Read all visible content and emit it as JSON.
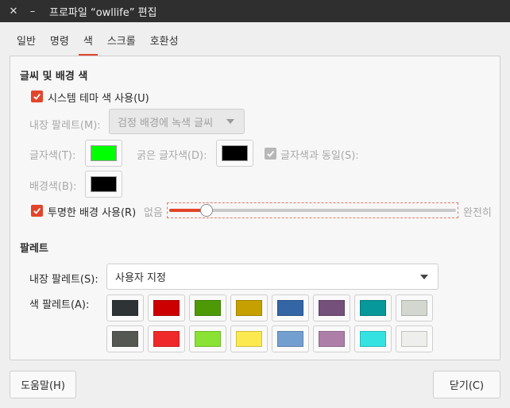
{
  "window": {
    "title": "프로파일 “owllife” 편집",
    "close_glyph": "✕",
    "minimize_glyph": "–"
  },
  "tabs": [
    {
      "label": "일반",
      "active": false
    },
    {
      "label": "명령",
      "active": false
    },
    {
      "label": "색",
      "active": true
    },
    {
      "label": "스크롤",
      "active": false
    },
    {
      "label": "호환성",
      "active": false
    }
  ],
  "text_bg": {
    "heading": "글씨 및 배경 색",
    "use_system_theme": {
      "label": "시스템 테마 색 사용(U)",
      "checked": true
    },
    "builtin_scheme": {
      "label": "내장 팔레트(M):",
      "value": "검정 배경에 녹색 글씨"
    },
    "text_color": {
      "label": "글자색(T):",
      "color": "#00ff00"
    },
    "bold_color": {
      "label": "굵은 글자색(D):",
      "color": "#000000"
    },
    "same_as_text": {
      "label": "글자색과 동일(S):",
      "checked": true
    },
    "bg_color": {
      "label": "배경색(B):",
      "color": "#000000"
    },
    "transparent_bg": {
      "label": "투명한 배경 사용(R)",
      "checked": true
    },
    "transparency": {
      "min_label": "없음",
      "max_label": "완전히",
      "value": 0.13
    }
  },
  "palette": {
    "heading": "팔레트",
    "builtin": {
      "label": "내장 팔레트(S):",
      "value": "사용자 지정"
    },
    "colors_label": "색 팔레트(A):",
    "colors": [
      "#2e3436",
      "#cc0000",
      "#4e9a06",
      "#c4a000",
      "#3465a4",
      "#75507b",
      "#06989a",
      "#d3d7cf",
      "#555753",
      "#ef2929",
      "#8ae234",
      "#fce94f",
      "#729fcf",
      "#ad7fa8",
      "#34e2e2",
      "#eeeeec"
    ]
  },
  "footer": {
    "help_label": "도움말(H)",
    "close_label": "닫기(C)"
  },
  "accent": "#e2452b"
}
